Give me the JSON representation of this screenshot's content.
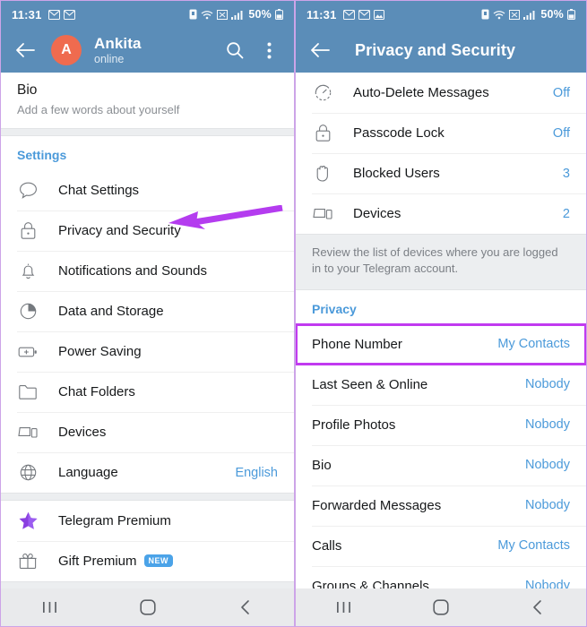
{
  "left_screen": {
    "status_bar": {
      "time": "11:31",
      "left_icons": [
        "gmail-icon",
        "gmail-icon"
      ],
      "right_icons": [
        "alarm-icon",
        "wifi-icon",
        "nfc-icon",
        "signal-icon"
      ],
      "battery_percent": "50%"
    },
    "app_bar": {
      "back_icon": "back-arrow-icon",
      "avatar_initial": "A",
      "avatar_color": "#ef6b4f",
      "title": "Ankita",
      "subtitle": "online",
      "search_icon": "search-icon",
      "menu_icon": "overflow-menu-icon"
    },
    "bio": {
      "title": "Bio",
      "subtitle": "Add a few words about yourself"
    },
    "settings_section": {
      "header": "Settings",
      "items": [
        {
          "icon": "chat-bubble-icon",
          "label": "Chat Settings",
          "value": ""
        },
        {
          "icon": "lock-icon",
          "label": "Privacy and Security",
          "value": ""
        },
        {
          "icon": "bell-icon",
          "label": "Notifications and Sounds",
          "value": ""
        },
        {
          "icon": "pie-clock-icon",
          "label": "Data and Storage",
          "value": ""
        },
        {
          "icon": "battery-plus-icon",
          "label": "Power Saving",
          "value": ""
        },
        {
          "icon": "folder-icon",
          "label": "Chat Folders",
          "value": ""
        },
        {
          "icon": "devices-icon",
          "label": "Devices",
          "value": ""
        },
        {
          "icon": "globe-icon",
          "label": "Language",
          "value": "English"
        }
      ]
    },
    "premium_section": {
      "items": [
        {
          "icon": "star-icon",
          "label": "Telegram Premium",
          "badge": ""
        },
        {
          "icon": "gift-icon",
          "label": "Gift Premium",
          "badge": "NEW"
        }
      ]
    },
    "nav_bar": {
      "recents_icon": "recents-icon",
      "home_icon": "home-icon",
      "back_icon": "back-chevron-icon"
    },
    "annotation": {
      "arrow_color": "#b43cef",
      "points_to": "Privacy and Security"
    }
  },
  "right_screen": {
    "status_bar": {
      "time": "11:31",
      "left_icons": [
        "gmail-icon",
        "gmail-icon",
        "photo-icon"
      ],
      "right_icons": [
        "alarm-icon",
        "wifi-icon",
        "nfc-icon",
        "signal-icon"
      ],
      "battery_percent": "50%"
    },
    "app_bar": {
      "back_icon": "back-arrow-icon",
      "title": "Privacy and Security"
    },
    "security_items": [
      {
        "icon": "auto-delete-timer-icon",
        "label": "Auto-Delete Messages",
        "value": "Off"
      },
      {
        "icon": "lock-icon",
        "label": "Passcode Lock",
        "value": "Off"
      },
      {
        "icon": "hand-block-icon",
        "label": "Blocked Users",
        "value": "3"
      },
      {
        "icon": "devices-icon",
        "label": "Devices",
        "value": "2"
      }
    ],
    "info_text": "Review the list of devices where you are logged in to your Telegram account.",
    "privacy_section": {
      "header": "Privacy",
      "items": [
        {
          "label": "Phone Number",
          "value": "My Contacts",
          "highlighted": true
        },
        {
          "label": "Last Seen & Online",
          "value": "Nobody",
          "highlighted": false
        },
        {
          "label": "Profile Photos",
          "value": "Nobody",
          "highlighted": false
        },
        {
          "label": "Bio",
          "value": "Nobody",
          "highlighted": false
        },
        {
          "label": "Forwarded Messages",
          "value": "Nobody",
          "highlighted": false
        },
        {
          "label": "Calls",
          "value": "My Contacts",
          "highlighted": false
        },
        {
          "label": "Groups & Channels",
          "value": "Nobody",
          "highlighted": false
        }
      ]
    },
    "nav_bar": {
      "recents_icon": "recents-icon",
      "home_icon": "home-icon",
      "back_icon": "back-chevron-icon"
    },
    "highlight_color": "#c13af0"
  }
}
